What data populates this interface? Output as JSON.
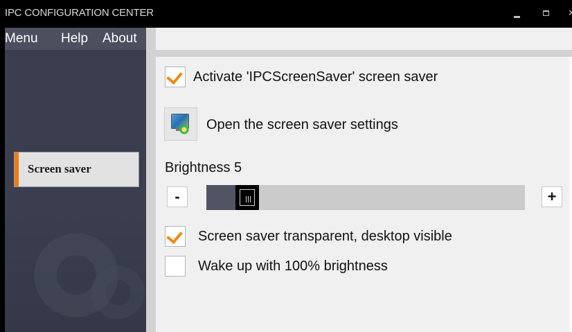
{
  "window": {
    "title": "IPC CONFIGURATION CENTER",
    "controls": {
      "minimize": "minimize-icon",
      "maximize": "maximize-icon",
      "close": "close-icon"
    }
  },
  "menubar": {
    "items": [
      {
        "label": "Menu"
      },
      {
        "label": "Help"
      },
      {
        "label": "About"
      }
    ]
  },
  "sidebar": {
    "items": [
      {
        "label": "Screen saver",
        "selected": true
      }
    ]
  },
  "settings": {
    "activate": {
      "label": "Activate 'IPCScreenSaver' screen saver",
      "checked": true
    },
    "open_settings": {
      "label": "Open the screen saver settings",
      "icon": "screen-saver-settings-icon"
    },
    "brightness": {
      "label": "Brightness 5",
      "value": 5,
      "min": 0,
      "max": 100,
      "minus_label": "-",
      "plus_label": "+"
    },
    "transparent": {
      "label": "Screen saver transparent, desktop visible",
      "checked": true
    },
    "wake_full": {
      "label": "Wake up with 100% brightness",
      "checked": false
    }
  },
  "colors": {
    "accent": "#f07d10",
    "titlebar": "#000000",
    "sidebar": "#3a3e4e",
    "content_bg": "#f0f0f0",
    "slider_track": "#cbcbcb",
    "slider_fill": "#505464"
  }
}
